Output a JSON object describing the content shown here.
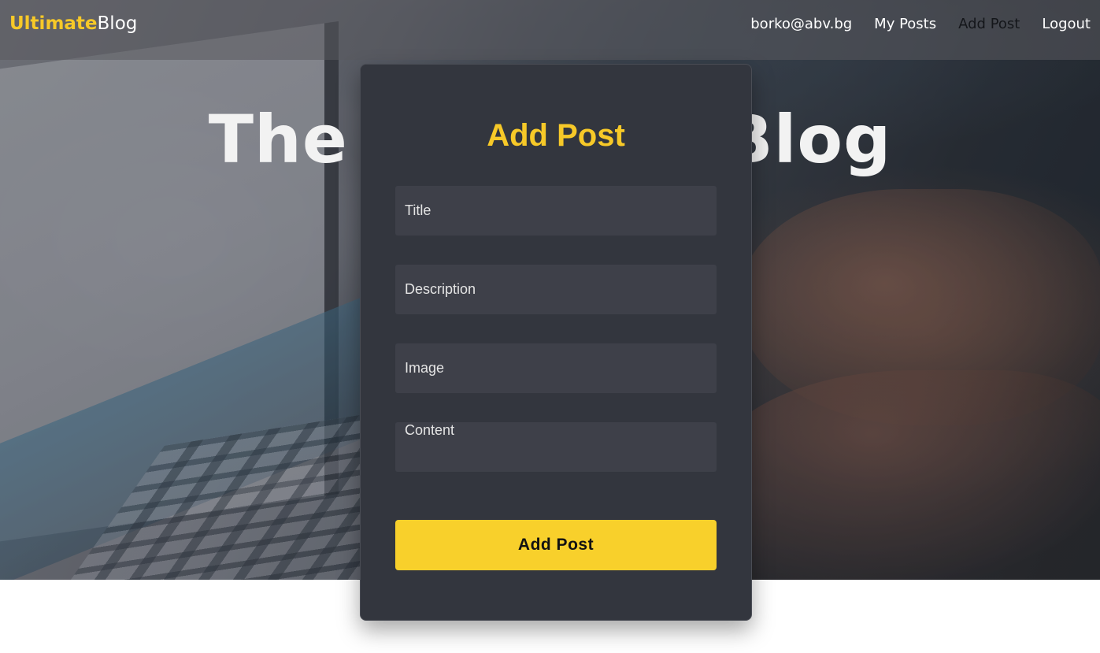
{
  "navbar": {
    "brand_part1": "Ultimate",
    "brand_part2": "Blog",
    "links": [
      {
        "label": "borko@abv.bg"
      },
      {
        "label": "My Posts"
      },
      {
        "label": "Add Post"
      },
      {
        "label": "Logout"
      }
    ]
  },
  "hero": {
    "title": "The Ultimate Blog"
  },
  "form": {
    "title": "Add Post",
    "fields": {
      "title_placeholder": "Title",
      "description_placeholder": "Description",
      "image_placeholder": "Image",
      "content_placeholder": "Content"
    },
    "submit_label": "Add Post"
  },
  "colors": {
    "accent": "#f8d02b",
    "card_bg": "#33363e",
    "field_bg": "#3e4049"
  }
}
